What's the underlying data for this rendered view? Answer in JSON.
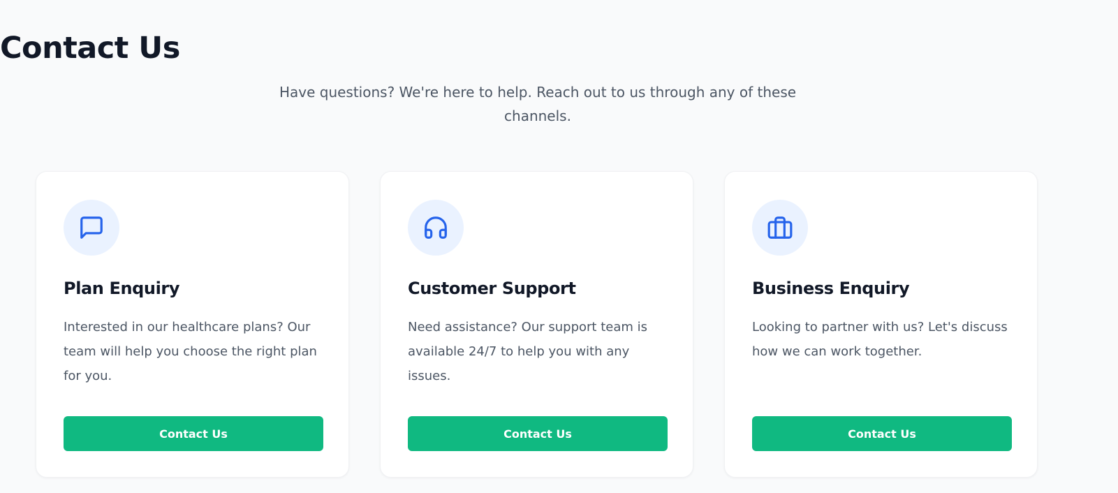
{
  "header": {
    "title": "Contact Us",
    "subtitle": "Have questions? We're here to help. Reach out to us through any of these channels."
  },
  "cards": [
    {
      "icon": "message-square-icon",
      "title": "Plan Enquiry",
      "description": "Interested in our healthcare plans? Our team will help you choose the right plan for you.",
      "button_label": "Contact Us"
    },
    {
      "icon": "headphones-icon",
      "title": "Customer Support",
      "description": "Need assistance? Our support team is available 24/7 to help you with any issues.",
      "button_label": "Contact Us"
    },
    {
      "icon": "briefcase-icon",
      "title": "Business Enquiry",
      "description": "Looking to partner with us? Let's discuss how we can work together.",
      "button_label": "Contact Us"
    }
  ],
  "colors": {
    "accent": "#10b981",
    "icon": "#2563eb",
    "icon_background": "#eaf2ff",
    "page_background": "#f9fafb"
  }
}
